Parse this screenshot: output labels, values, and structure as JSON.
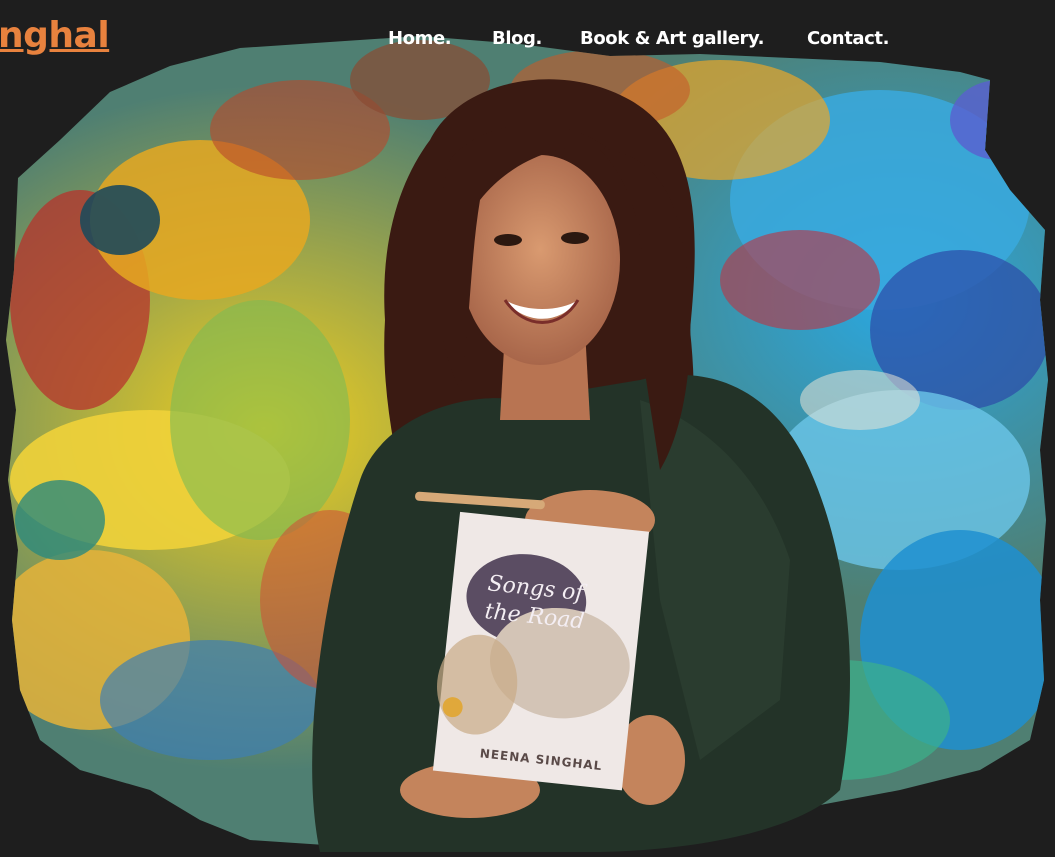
{
  "header": {
    "logo_text": "nghal",
    "logo_color": "#e8823e"
  },
  "nav": {
    "items": [
      {
        "label": "Home."
      },
      {
        "label": "Blog."
      },
      {
        "label": "Book & Art gallery."
      },
      {
        "label": "Contact."
      }
    ]
  },
  "hero": {
    "book": {
      "title": "Songs of the Road",
      "author": "NEENA SINGHAL"
    }
  },
  "colors": {
    "background": "#1e1e1e",
    "nav_text": "#ffffff",
    "accent": "#e8823e"
  }
}
